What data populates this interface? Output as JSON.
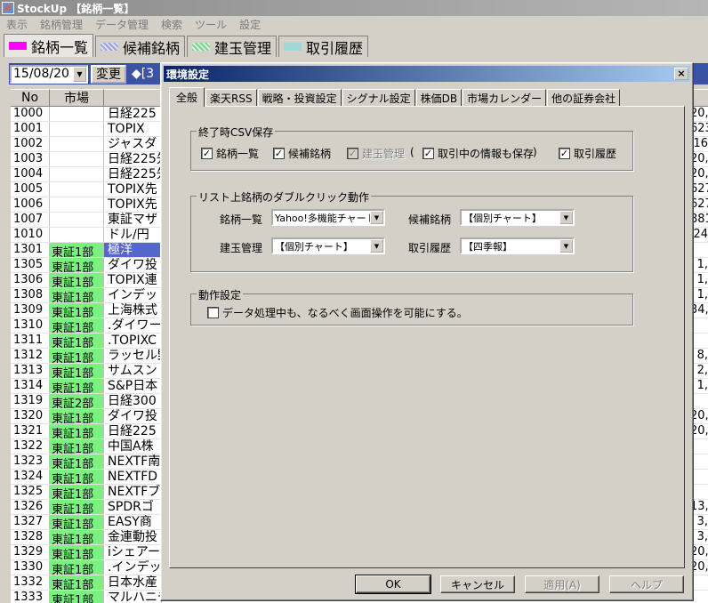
{
  "app": {
    "title": "StockUp 【銘柄一覧】"
  },
  "menu": [
    "表示",
    "銘柄管理",
    "データ管理",
    "検索",
    "ツール",
    "設定"
  ],
  "main_tabs": [
    {
      "label": "銘柄一覧",
      "color": "#ff00ff"
    },
    {
      "label": "候補銘柄",
      "color": "#9aa0d6"
    },
    {
      "label": "建玉管理",
      "color": "#7fcf8e"
    },
    {
      "label": "取引履歴",
      "color": "#9fd6d6"
    }
  ],
  "toolbar": {
    "date_value": "15/08/20",
    "change_label": "変更",
    "diamond_label": "◆[3"
  },
  "grid": {
    "headers": [
      "No",
      "市場"
    ],
    "rows": [
      {
        "no": "1000",
        "market": "",
        "name": "日経225",
        "right": "20,"
      },
      {
        "no": "1001",
        "market": "",
        "name": "TOPIX",
        "right": "623"
      },
      {
        "no": "1002",
        "market": "",
        "name": "ジャスダ",
        "right": "16"
      },
      {
        "no": "1003",
        "market": "",
        "name": "日経225先",
        "right": "20,"
      },
      {
        "no": "1004",
        "market": "",
        "name": "日経225先",
        "right": "20,"
      },
      {
        "no": "1005",
        "market": "",
        "name": "TOPIX先",
        "right": "627"
      },
      {
        "no": "1006",
        "market": "",
        "name": "TOPIX先",
        "right": "627"
      },
      {
        "no": "1007",
        "market": "",
        "name": "東証マザ",
        "right": "881"
      },
      {
        "no": "1010",
        "market": "",
        "name": "ドル/円",
        "right": "24"
      },
      {
        "no": "1301",
        "market": "東証1部",
        "name": "極洋",
        "right": ""
      },
      {
        "no": "1305",
        "market": "東証1部",
        "name": "ダイワ投",
        "right": "1,"
      },
      {
        "no": "1306",
        "market": "東証1部",
        "name": "TOPIX連",
        "right": "1,"
      },
      {
        "no": "1308",
        "market": "東証1部",
        "name": "インデッ",
        "right": "1,"
      },
      {
        "no": "1309",
        "market": "東証1部",
        "name": "上海株式",
        "right": "34,"
      },
      {
        "no": "1310",
        "market": "東証1部",
        "name": ".ダイワー",
        "right": ""
      },
      {
        "no": "1311",
        "market": "東証1部",
        "name": ".TOPIXC",
        "right": ""
      },
      {
        "no": "1312",
        "market": "東証1部",
        "name": "ラッセル野",
        "right": "8,"
      },
      {
        "no": "1313",
        "market": "東証1部",
        "name": "サムスン",
        "right": "2,"
      },
      {
        "no": "1314",
        "market": "東証1部",
        "name": "S&P日本",
        "right": "1,"
      },
      {
        "no": "1319",
        "market": "東証2部",
        "name": "日経300",
        "right": ""
      },
      {
        "no": "1320",
        "market": "東証1部",
        "name": "ダイワ投",
        "right": "20,"
      },
      {
        "no": "1321",
        "market": "東証1部",
        "name": "日経225",
        "right": "20,"
      },
      {
        "no": "1322",
        "market": "東証1部",
        "name": "中国A株",
        "right": ""
      },
      {
        "no": "1323",
        "market": "東証1部",
        "name": "NEXTF南",
        "right": ""
      },
      {
        "no": "1324",
        "market": "東証1部",
        "name": "NEXTFD",
        "right": ""
      },
      {
        "no": "1325",
        "market": "東証1部",
        "name": "NEXTFブ",
        "right": ""
      },
      {
        "no": "1326",
        "market": "東証1部",
        "name": "SPDRゴ",
        "right": "13,"
      },
      {
        "no": "1327",
        "market": "東証1部",
        "name": "EASY商",
        "right": "3,"
      },
      {
        "no": "1328",
        "market": "東証1部",
        "name": "金連動投",
        "right": "3,"
      },
      {
        "no": "1329",
        "market": "東証1部",
        "name": "iシェアー",
        "right": "20,"
      },
      {
        "no": "1330",
        "market": "東証1部",
        "name": ".インデッ",
        "right": "20,"
      },
      {
        "no": "1332",
        "market": "東証1部",
        "name": "日本水産",
        "right": ""
      },
      {
        "no": "1333",
        "market": "東証1部",
        "name": "マルハニチ",
        "right": ""
      }
    ]
  },
  "dialog": {
    "title": "環境設定",
    "close": "×",
    "tabs": [
      "全般",
      "楽天RSS",
      "戦略・投資設定",
      "シグナル設定",
      "株価DB",
      "市場カレンダー",
      "他の証券会社"
    ],
    "csv_group": {
      "label": "終了時CSV保存",
      "items": [
        {
          "label": "銘柄一覧",
          "checked": true,
          "disabled": false
        },
        {
          "label": "候補銘柄",
          "checked": true,
          "disabled": false
        },
        {
          "label": "建玉管理",
          "checked": true,
          "disabled": true
        },
        {
          "label": "取引中の情報も保存",
          "checked": true,
          "disabled": false
        },
        {
          "label": "取引履歴",
          "checked": true,
          "disabled": false
        }
      ],
      "paren_open": "(",
      "paren_close": ")"
    },
    "dblclick_group": {
      "label": "リスト上銘柄のダブルクリック動作",
      "fields": [
        {
          "label": "銘柄一覧",
          "value": "Yahoo!多機能チャート"
        },
        {
          "label": "候補銘柄",
          "value": "【個別チャート】"
        },
        {
          "label": "建玉管理",
          "value": "【個別チャート】"
        },
        {
          "label": "取引履歴",
          "value": "【四季報】"
        }
      ]
    },
    "behavior_group": {
      "label": "動作設定",
      "option": "データ処理中も、なるべく画面操作を可能にする。",
      "checked": false
    },
    "buttons": {
      "ok": "OK",
      "cancel": "キャンセル",
      "apply": "適用(A)",
      "help": "ヘルプ"
    }
  }
}
